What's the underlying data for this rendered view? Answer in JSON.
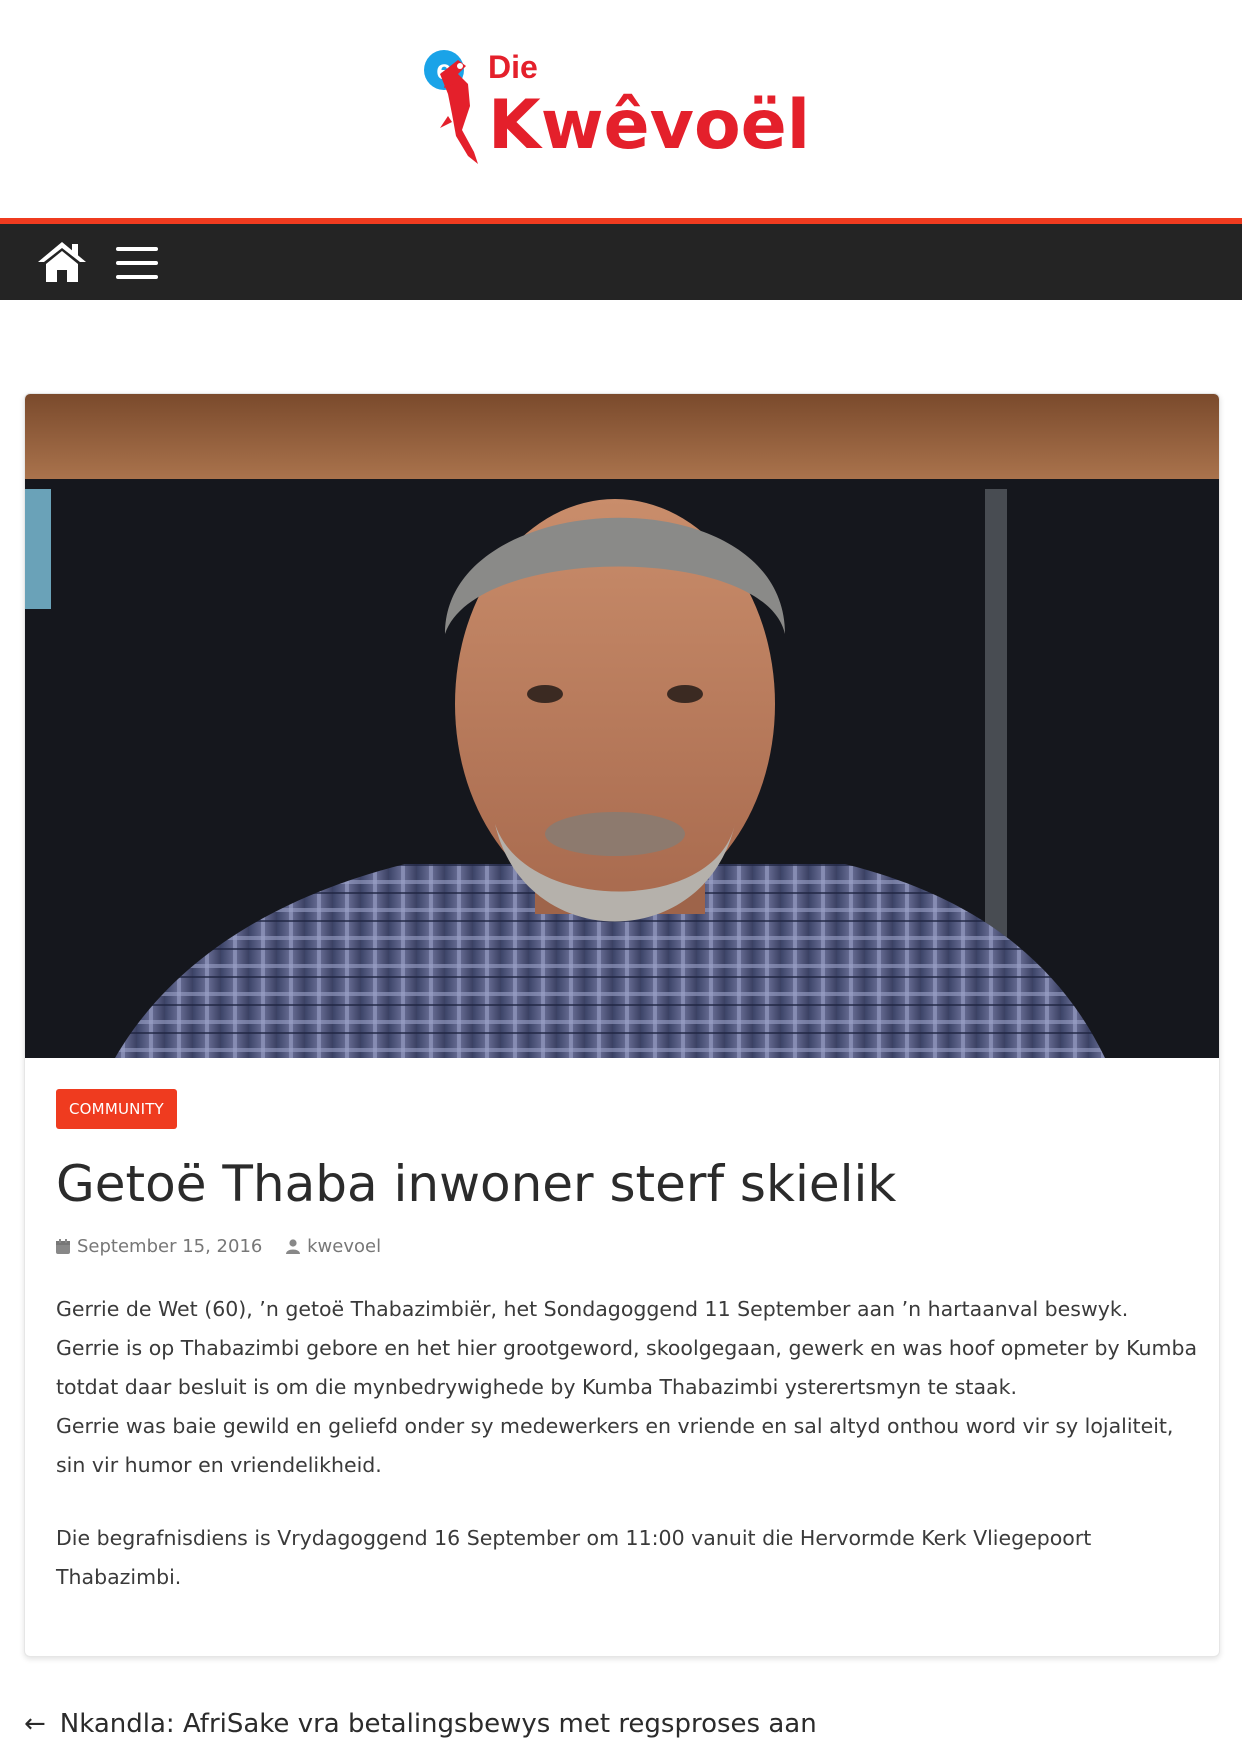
{
  "brand": {
    "logo_top": "Die",
    "logo_main": "Kwêvoël",
    "logo_badge": "e",
    "red": "#ef3b1f",
    "blue": "#1aa3e8"
  },
  "nav": {
    "home_icon": "home-icon",
    "menu_icon": "hamburger-menu-icon",
    "background": "#242424"
  },
  "article": {
    "category": "COMMUNITY",
    "title": "Getoë Thaba inwoner sterf skielik",
    "date": "September 15, 2016",
    "author": "kwevoel",
    "paragraphs": [
      "Gerrie de Wet (60), ’n getoë Thabazimbiër, het Sondagoggend 11 September aan ’n hartaanval beswyk.",
      "Gerrie is op Thabazimbi gebore en het hier grootgeword, skoolgegaan, gewerk en was hoof opmeter by Kumba totdat daar besluit is om die mynbedrywighede by Kumba Thabazimbi ysterertsmyn te staak.",
      "Gerrie was baie gewild en geliefd onder sy medewerkers en vriende en sal altyd onthou word vir sy lojaliteit, sin vir humor en vriendelikheid.",
      "Die begrafnisdiens is Vrydagoggend 16 September om 11:00 vanuit die Hervormde Kerk Vliegepoort Thabazimbi."
    ]
  },
  "post_nav": {
    "arrow": "←",
    "previous_title": "Nkandla: AfriSake vra betalingsbewys met regsproses aan"
  }
}
